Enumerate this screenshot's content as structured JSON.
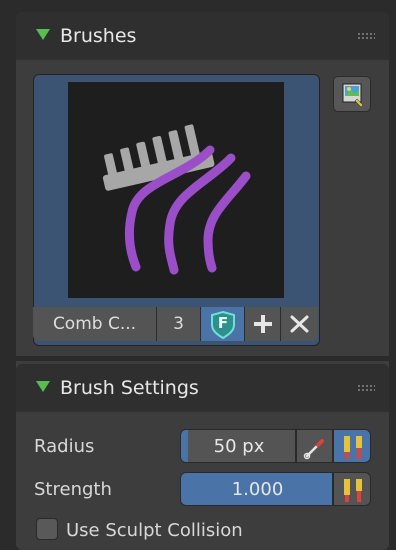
{
  "brushes_panel": {
    "title": "Brushes",
    "brush_name": "Comb C...",
    "user_count": "3",
    "fake_user_icon": "F"
  },
  "brush_settings_panel": {
    "title": "Brush Settings",
    "radius": {
      "label": "Radius",
      "value": "50 px"
    },
    "strength": {
      "label": "Strength",
      "value": "1.000",
      "fill_fraction": 1.0
    },
    "use_sculpt_collision": {
      "label": "Use Sculpt Collision",
      "checked": false
    }
  },
  "colors": {
    "accent_blue": "#4a73a8",
    "collapse_arrow_green": "#55c14d",
    "comb_purple": "#9a4fc9"
  }
}
